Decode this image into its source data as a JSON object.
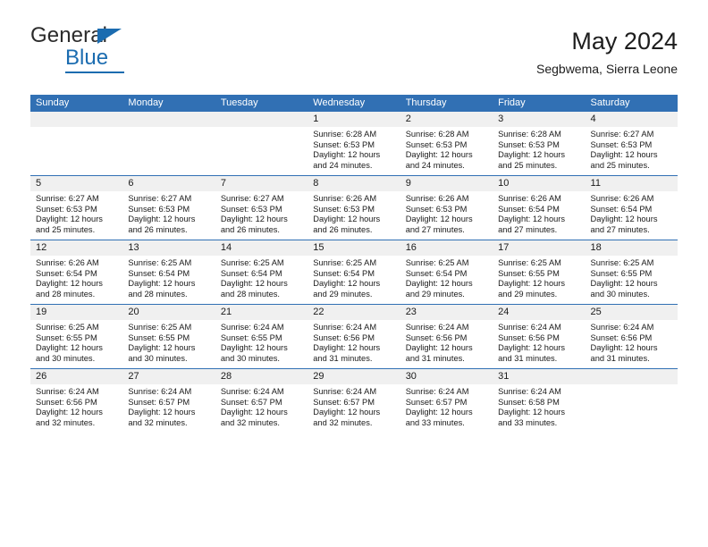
{
  "brand": {
    "name_top": "General",
    "name_bottom": "Blue",
    "triangle_color": "#1b6cb0"
  },
  "header": {
    "title": "May 2024",
    "subtitle": "Segbwema, Sierra Leone"
  },
  "theme": {
    "header_blue": "#3170b4",
    "daynum_gray": "#f0f0f0",
    "text": "#1a1a1a"
  },
  "weekdays": [
    "Sunday",
    "Monday",
    "Tuesday",
    "Wednesday",
    "Thursday",
    "Friday",
    "Saturday"
  ],
  "weeks": [
    [
      {
        "day": "",
        "lines": []
      },
      {
        "day": "",
        "lines": []
      },
      {
        "day": "",
        "lines": []
      },
      {
        "day": "1",
        "lines": [
          "Sunrise: 6:28 AM",
          "Sunset: 6:53 PM",
          "Daylight: 12 hours",
          "and 24 minutes."
        ]
      },
      {
        "day": "2",
        "lines": [
          "Sunrise: 6:28 AM",
          "Sunset: 6:53 PM",
          "Daylight: 12 hours",
          "and 24 minutes."
        ]
      },
      {
        "day": "3",
        "lines": [
          "Sunrise: 6:28 AM",
          "Sunset: 6:53 PM",
          "Daylight: 12 hours",
          "and 25 minutes."
        ]
      },
      {
        "day": "4",
        "lines": [
          "Sunrise: 6:27 AM",
          "Sunset: 6:53 PM",
          "Daylight: 12 hours",
          "and 25 minutes."
        ]
      }
    ],
    [
      {
        "day": "5",
        "lines": [
          "Sunrise: 6:27 AM",
          "Sunset: 6:53 PM",
          "Daylight: 12 hours",
          "and 25 minutes."
        ]
      },
      {
        "day": "6",
        "lines": [
          "Sunrise: 6:27 AM",
          "Sunset: 6:53 PM",
          "Daylight: 12 hours",
          "and 26 minutes."
        ]
      },
      {
        "day": "7",
        "lines": [
          "Sunrise: 6:27 AM",
          "Sunset: 6:53 PM",
          "Daylight: 12 hours",
          "and 26 minutes."
        ]
      },
      {
        "day": "8",
        "lines": [
          "Sunrise: 6:26 AM",
          "Sunset: 6:53 PM",
          "Daylight: 12 hours",
          "and 26 minutes."
        ]
      },
      {
        "day": "9",
        "lines": [
          "Sunrise: 6:26 AM",
          "Sunset: 6:53 PM",
          "Daylight: 12 hours",
          "and 27 minutes."
        ]
      },
      {
        "day": "10",
        "lines": [
          "Sunrise: 6:26 AM",
          "Sunset: 6:54 PM",
          "Daylight: 12 hours",
          "and 27 minutes."
        ]
      },
      {
        "day": "11",
        "lines": [
          "Sunrise: 6:26 AM",
          "Sunset: 6:54 PM",
          "Daylight: 12 hours",
          "and 27 minutes."
        ]
      }
    ],
    [
      {
        "day": "12",
        "lines": [
          "Sunrise: 6:26 AM",
          "Sunset: 6:54 PM",
          "Daylight: 12 hours",
          "and 28 minutes."
        ]
      },
      {
        "day": "13",
        "lines": [
          "Sunrise: 6:25 AM",
          "Sunset: 6:54 PM",
          "Daylight: 12 hours",
          "and 28 minutes."
        ]
      },
      {
        "day": "14",
        "lines": [
          "Sunrise: 6:25 AM",
          "Sunset: 6:54 PM",
          "Daylight: 12 hours",
          "and 28 minutes."
        ]
      },
      {
        "day": "15",
        "lines": [
          "Sunrise: 6:25 AM",
          "Sunset: 6:54 PM",
          "Daylight: 12 hours",
          "and 29 minutes."
        ]
      },
      {
        "day": "16",
        "lines": [
          "Sunrise: 6:25 AM",
          "Sunset: 6:54 PM",
          "Daylight: 12 hours",
          "and 29 minutes."
        ]
      },
      {
        "day": "17",
        "lines": [
          "Sunrise: 6:25 AM",
          "Sunset: 6:55 PM",
          "Daylight: 12 hours",
          "and 29 minutes."
        ]
      },
      {
        "day": "18",
        "lines": [
          "Sunrise: 6:25 AM",
          "Sunset: 6:55 PM",
          "Daylight: 12 hours",
          "and 30 minutes."
        ]
      }
    ],
    [
      {
        "day": "19",
        "lines": [
          "Sunrise: 6:25 AM",
          "Sunset: 6:55 PM",
          "Daylight: 12 hours",
          "and 30 minutes."
        ]
      },
      {
        "day": "20",
        "lines": [
          "Sunrise: 6:25 AM",
          "Sunset: 6:55 PM",
          "Daylight: 12 hours",
          "and 30 minutes."
        ]
      },
      {
        "day": "21",
        "lines": [
          "Sunrise: 6:24 AM",
          "Sunset: 6:55 PM",
          "Daylight: 12 hours",
          "and 30 minutes."
        ]
      },
      {
        "day": "22",
        "lines": [
          "Sunrise: 6:24 AM",
          "Sunset: 6:56 PM",
          "Daylight: 12 hours",
          "and 31 minutes."
        ]
      },
      {
        "day": "23",
        "lines": [
          "Sunrise: 6:24 AM",
          "Sunset: 6:56 PM",
          "Daylight: 12 hours",
          "and 31 minutes."
        ]
      },
      {
        "day": "24",
        "lines": [
          "Sunrise: 6:24 AM",
          "Sunset: 6:56 PM",
          "Daylight: 12 hours",
          "and 31 minutes."
        ]
      },
      {
        "day": "25",
        "lines": [
          "Sunrise: 6:24 AM",
          "Sunset: 6:56 PM",
          "Daylight: 12 hours",
          "and 31 minutes."
        ]
      }
    ],
    [
      {
        "day": "26",
        "lines": [
          "Sunrise: 6:24 AM",
          "Sunset: 6:56 PM",
          "Daylight: 12 hours",
          "and 32 minutes."
        ]
      },
      {
        "day": "27",
        "lines": [
          "Sunrise: 6:24 AM",
          "Sunset: 6:57 PM",
          "Daylight: 12 hours",
          "and 32 minutes."
        ]
      },
      {
        "day": "28",
        "lines": [
          "Sunrise: 6:24 AM",
          "Sunset: 6:57 PM",
          "Daylight: 12 hours",
          "and 32 minutes."
        ]
      },
      {
        "day": "29",
        "lines": [
          "Sunrise: 6:24 AM",
          "Sunset: 6:57 PM",
          "Daylight: 12 hours",
          "and 32 minutes."
        ]
      },
      {
        "day": "30",
        "lines": [
          "Sunrise: 6:24 AM",
          "Sunset: 6:57 PM",
          "Daylight: 12 hours",
          "and 33 minutes."
        ]
      },
      {
        "day": "31",
        "lines": [
          "Sunrise: 6:24 AM",
          "Sunset: 6:58 PM",
          "Daylight: 12 hours",
          "and 33 minutes."
        ]
      },
      {
        "day": "",
        "lines": []
      }
    ]
  ]
}
